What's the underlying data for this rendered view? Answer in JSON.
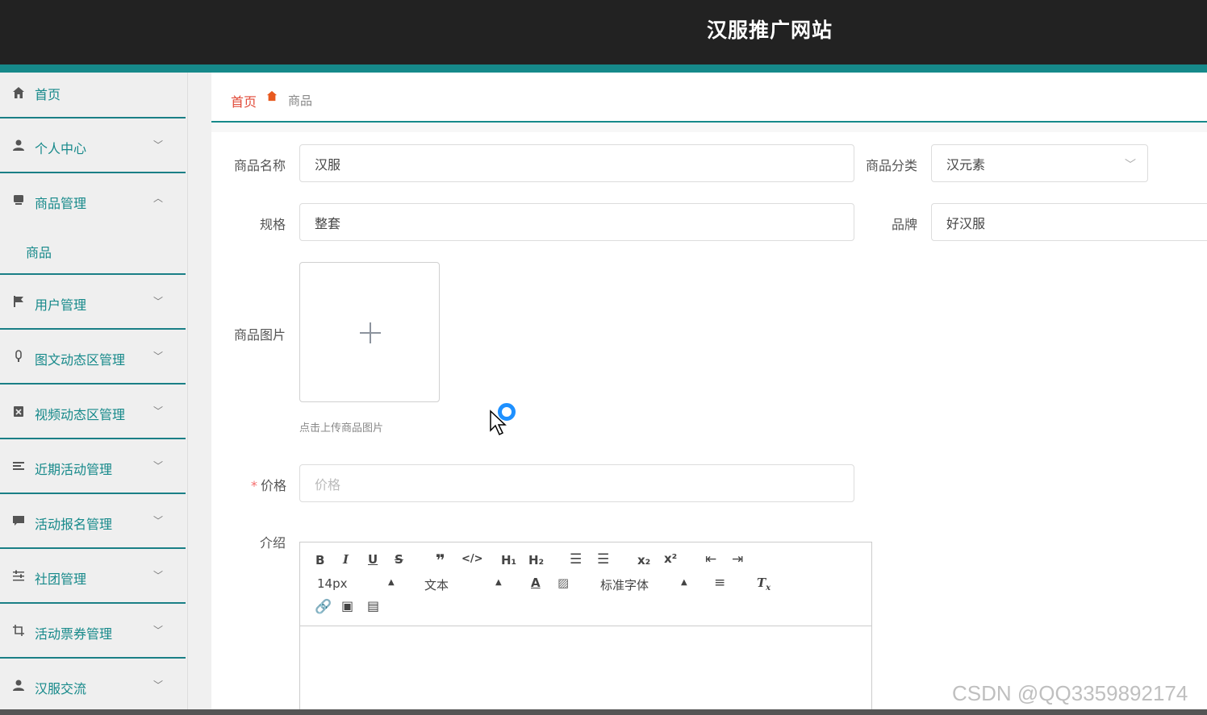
{
  "header": {
    "title": "汉服推广网站"
  },
  "sidebar": {
    "items": [
      {
        "label": "首页",
        "icon": "home-icon",
        "expandable": false
      },
      {
        "label": "个人中心",
        "icon": "user-icon",
        "expandable": true
      },
      {
        "label": "商品管理",
        "icon": "shop-icon",
        "expandable": true,
        "expanded": true
      },
      {
        "label": "用户管理",
        "icon": "flag-icon",
        "expandable": true
      },
      {
        "label": "图文动态区管理",
        "icon": "mic-icon",
        "expandable": true
      },
      {
        "label": "视频动态区管理",
        "icon": "clipboard-icon",
        "expandable": true
      },
      {
        "label": "近期活动管理",
        "icon": "list-icon",
        "expandable": true
      },
      {
        "label": "活动报名管理",
        "icon": "chat-icon",
        "expandable": true
      },
      {
        "label": "社团管理",
        "icon": "sliders-icon",
        "expandable": true
      },
      {
        "label": "活动票券管理",
        "icon": "crop-icon",
        "expandable": true
      },
      {
        "label": "汉服交流",
        "icon": "user-icon",
        "expandable": true
      }
    ],
    "subitem": "商品"
  },
  "breadcrumb": {
    "home": "首页",
    "current": "商品"
  },
  "form": {
    "name_label": "商品名称",
    "name_value": "汉服",
    "category_label": "商品分类",
    "category_value": "汉元素",
    "spec_label": "规格",
    "spec_value": "整套",
    "brand_label": "品牌",
    "brand_value": "好汉服",
    "image_label": "商品图片",
    "image_tip": "点击上传商品图片",
    "price_label": "价格",
    "price_placeholder": "价格",
    "intro_label": "介绍"
  },
  "editor": {
    "font_size": "14px",
    "header_select": "文本",
    "font_family": "标准字体"
  },
  "watermark": "CSDN @QQ3359892174"
}
